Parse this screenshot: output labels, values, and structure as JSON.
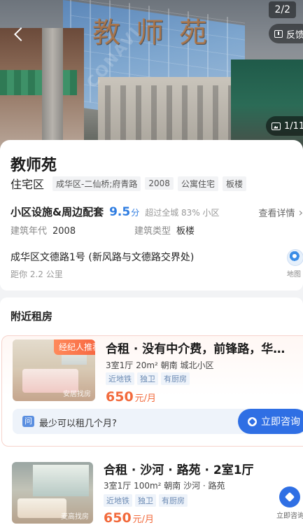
{
  "hero": {
    "image_index": "2/2",
    "sign_text": "教师苑",
    "watermark": "CONAVI",
    "feedback_label": "反馈",
    "photo_count": "1/11"
  },
  "community": {
    "name": "教师苑",
    "type": "住宅区",
    "tags": [
      "成华区-二仙桥;府青路",
      "2008",
      "公寓住宅",
      "板楼"
    ],
    "facility_title": "小区设施&周边配套",
    "score": "9.5",
    "score_unit": "分",
    "score_compare": "超过全城 83% 小区",
    "detail_link": "查看详情",
    "build_year_label": "建筑年代",
    "build_year": "2008",
    "build_type_label": "建筑类型",
    "build_type": "板楼",
    "address": "成华区文德路1号 (新风路与文德路交界处)",
    "distance": "距你 2.2 公里",
    "map_label": "地图"
  },
  "nearby": {
    "title": "附近租房",
    "listings": [
      {
        "badge": "经纪人推荐",
        "thumb_watermark": "安居找房",
        "title": "合租 · 没有中介费，前锋路，华…",
        "meta": "3室1厅  20m²  朝南  城北小区",
        "tags": [
          "近地铁",
          "独卫",
          "有厨房"
        ],
        "price": "650",
        "price_unit": "元/月",
        "question": "最少可以租几个月?",
        "question_icon": "问",
        "consult_label": "立即咨询"
      },
      {
        "thumb_watermark": "麦高找房",
        "title": "合租 · 沙河 · 路苑 · 2室1厅",
        "meta": "3室1厅  100m²  朝南  沙河 · 路苑",
        "tags": [
          "近地铁",
          "独卫",
          "有厨房"
        ],
        "price": "650",
        "price_unit": "元/月",
        "consult_label": "立即咨询"
      }
    ]
  }
}
